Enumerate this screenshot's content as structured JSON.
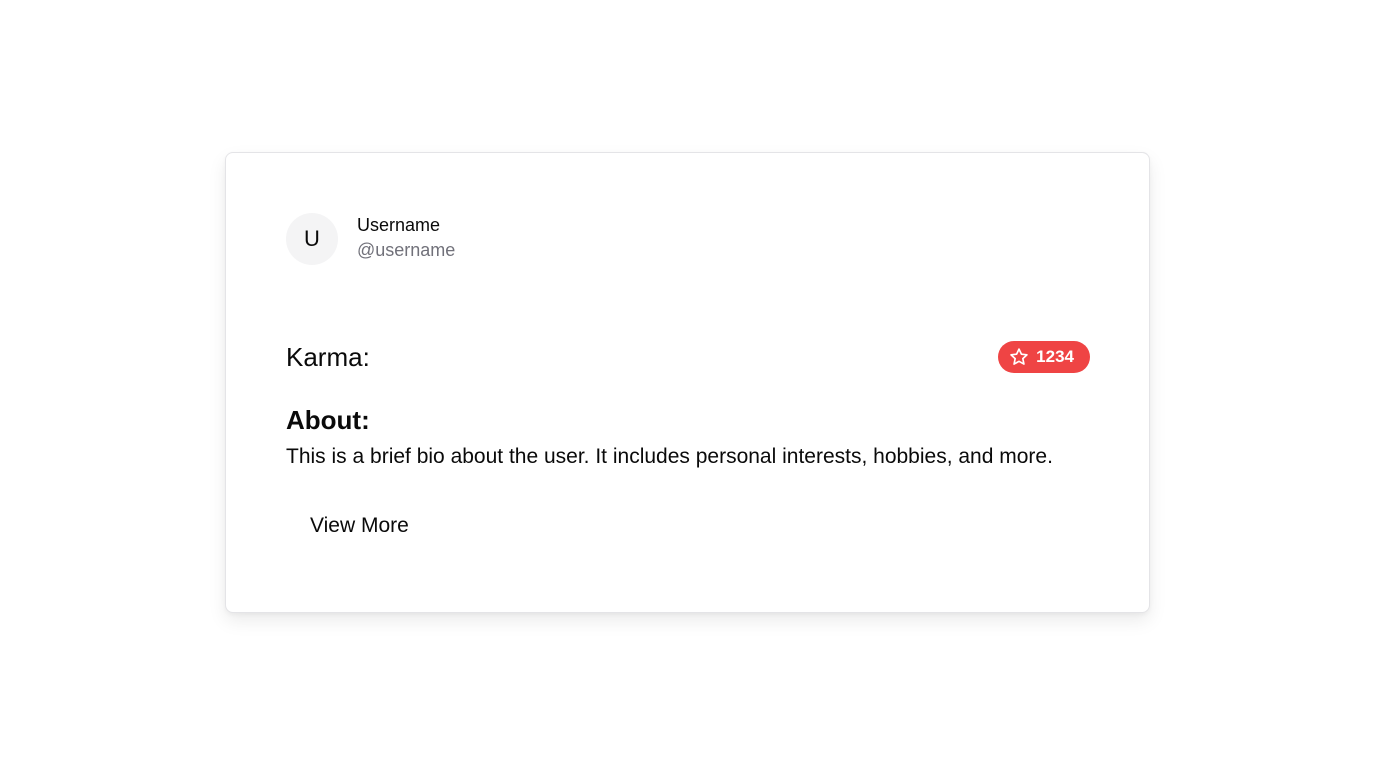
{
  "profile": {
    "avatar_initial": "U",
    "display_name": "Username",
    "handle": "@username"
  },
  "karma": {
    "label": "Karma:",
    "value": "1234",
    "icon": "star-icon",
    "badge_color": "#ef4444"
  },
  "about": {
    "title": "About:",
    "bio": "This is a brief bio about the user. It includes personal interests, hobbies, and more."
  },
  "actions": {
    "view_more_label": "View More"
  }
}
